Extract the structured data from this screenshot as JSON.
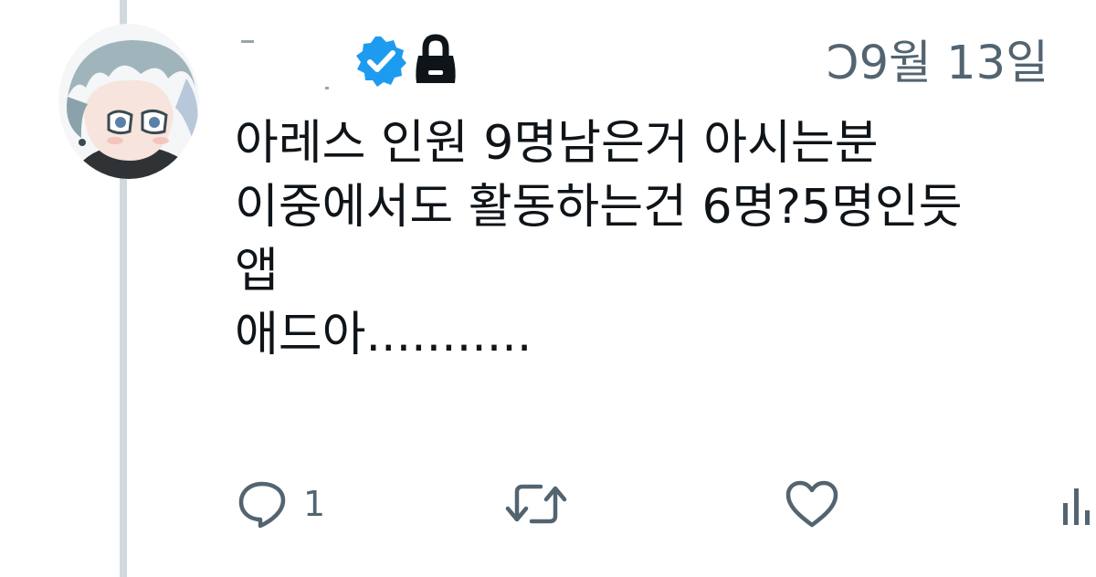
{
  "tweet": {
    "timestamp": "Ͻ9월 13일",
    "text_lines": [
      "아레스 인원 9명남은거 아시는분",
      "이중에서도 활동하는건 6명?5명인듯",
      "앱",
      "애드아..........."
    ],
    "badges": {
      "verified": "verified-badge-icon",
      "protected": "lock-icon"
    }
  },
  "actions": {
    "reply_count": "1",
    "reply_icon": "reply-icon",
    "retweet_icon": "retweet-icon",
    "like_icon": "heart-icon",
    "views_icon": "views-icon"
  },
  "colors": {
    "text": "#0f1419",
    "muted": "#536471",
    "verified_blue": "#1d9bf0",
    "thread_line": "#cfd9de"
  }
}
